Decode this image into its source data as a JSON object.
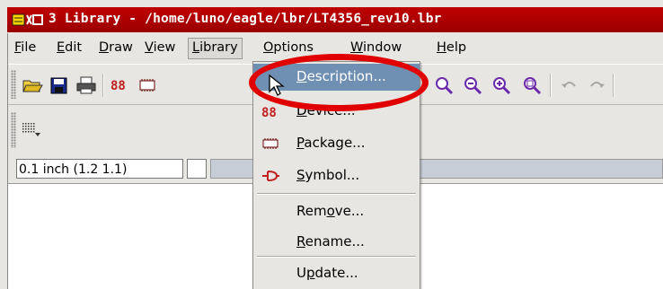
{
  "window": {
    "title": "3 Library - /home/luno/eagle/lbr/LT4356_rev10.lbr"
  },
  "menubar": {
    "items": [
      {
        "label_pre": "",
        "label_u": "F",
        "label_post": "ile"
      },
      {
        "label_pre": "",
        "label_u": "E",
        "label_post": "dit"
      },
      {
        "label_pre": "",
        "label_u": "D",
        "label_post": "raw"
      },
      {
        "label_pre": "",
        "label_u": "V",
        "label_post": "iew"
      },
      {
        "label_pre": "",
        "label_u": "L",
        "label_post": "ibrary"
      },
      {
        "label_pre": "",
        "label_u": "O",
        "label_post": "ptions"
      },
      {
        "label_pre": "",
        "label_u": "W",
        "label_post": "indow"
      },
      {
        "label_pre": "",
        "label_u": "H",
        "label_post": "elp"
      }
    ]
  },
  "toolbar": {
    "icons": [
      "open-folder-icon",
      "save-disk-icon",
      "print-icon",
      "device-icon",
      "package-icon",
      "zoom-fit-icon",
      "zoom-in-icon",
      "zoom-out-icon",
      "zoom-select-icon",
      "undo-icon",
      "redo-icon"
    ]
  },
  "status": {
    "coordinates": "0.1 inch (1.2 1.1)"
  },
  "library_menu": {
    "items": [
      {
        "label_pre": "",
        "label_u": "D",
        "label_post": "escription...",
        "icon": "",
        "highlighted": true
      },
      {
        "label_pre": "",
        "label_u": "D",
        "label_post": "evice...",
        "icon": "device-icon",
        "highlighted": false
      },
      {
        "label_pre": "",
        "label_u": "P",
        "label_post": "ackage...",
        "icon": "package-icon",
        "highlighted": false
      },
      {
        "label_pre": "",
        "label_u": "S",
        "label_post": "ymbol...",
        "icon": "symbol-icon",
        "highlighted": false
      },
      {
        "label_pre": "Rem",
        "label_u": "o",
        "label_post": "ve...",
        "icon": "",
        "highlighted": false
      },
      {
        "label_pre": "",
        "label_u": "R",
        "label_post": "ename...",
        "icon": "",
        "highlighted": false
      },
      {
        "label_pre": "U",
        "label_u": "p",
        "label_post": "date...",
        "icon": "",
        "highlighted": false
      }
    ]
  },
  "colors": {
    "titlebar": "#b00000",
    "highlight": "#6f8fb3",
    "annotation_ring": "#e00000"
  }
}
